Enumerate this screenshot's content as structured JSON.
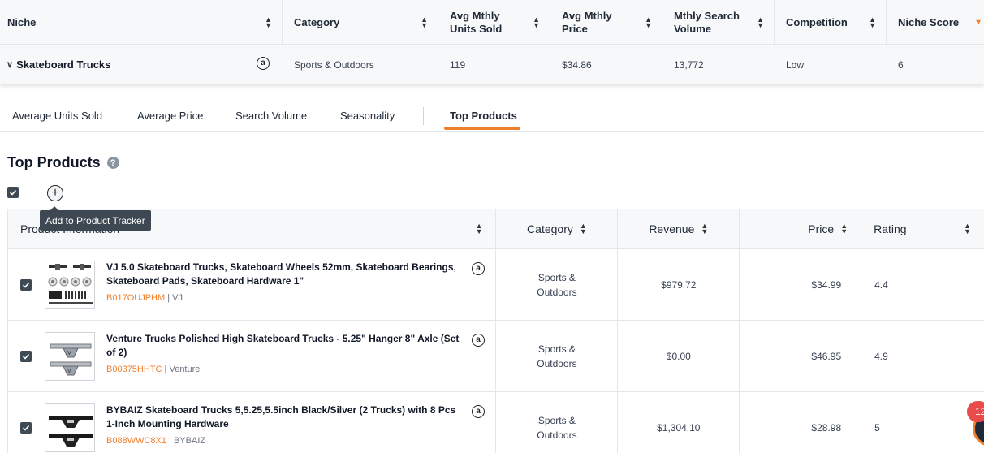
{
  "niche_table": {
    "headers": [
      {
        "line1": "Niche",
        "line2": ""
      },
      {
        "line1": "Category",
        "line2": ""
      },
      {
        "line1": "Avg Mthly",
        "line2": "Units Sold"
      },
      {
        "line1": "Avg Mthly",
        "line2": "Price"
      },
      {
        "line1": "Mthly Search",
        "line2": "Volume"
      },
      {
        "line1": "Competition",
        "line2": ""
      },
      {
        "line1": "Niche Score",
        "line2": ""
      }
    ],
    "row": {
      "niche": "Skateboard Trucks",
      "category": "Sports & Outdoors",
      "units_sold": "119",
      "price": "$34.86",
      "search_volume": "13,772",
      "competition": "Low",
      "niche_score": "6"
    }
  },
  "tabs": [
    "Average Units Sold",
    "Average Price",
    "Search Volume",
    "Seasonality",
    "Top Products"
  ],
  "active_tab": "Top Products",
  "section_title": "Top Products",
  "tooltip": "Add to Product Tracker",
  "products_table": {
    "headers": {
      "info": "Product Information",
      "category": "Category",
      "revenue": "Revenue",
      "price": "Price",
      "rating": "Rating"
    },
    "rows": [
      {
        "title": "VJ 5.0 Skateboard Trucks, Skateboard Wheels 52mm, Skateboard Bearings, Skateboard Pads, Skateboard Hardware 1\"",
        "asin": "B017OUJPHM",
        "brand": "VJ",
        "category": "Sports & Outdoors",
        "revenue": "$979.72",
        "price": "$34.99",
        "rating": "4.4"
      },
      {
        "title": "Venture Trucks Polished High Skateboard Trucks - 5.25\" Hanger 8\" Axle (Set of 2)",
        "asin": "B00375HHTC",
        "brand": "Venture",
        "category": "Sports & Outdoors",
        "revenue": "$0.00",
        "price": "$46.95",
        "rating": "4.9"
      },
      {
        "title": "BYBAIZ Skateboard Trucks 5,5.25,5.5inch Black/Silver (2 Trucks) with 8 Pcs 1-Inch Mounting Hardware",
        "asin": "B088WWC8X1",
        "brand": "BYBAIZ",
        "category": "Sports & Outdoors",
        "revenue": "$1,304.10",
        "price": "$28.98",
        "rating": "5"
      }
    ]
  },
  "notification_count": "12",
  "colors": {
    "accent": "#f07f2c",
    "header_bg": "#f7f8fa",
    "tooltip_bg": "#3d4852",
    "badge": "#e94b4b"
  },
  "icons": [
    "sort-icon",
    "amazon-icon",
    "chevron-down-icon",
    "help-icon",
    "checkbox-icon",
    "add-circle-icon",
    "chat-icon"
  ]
}
